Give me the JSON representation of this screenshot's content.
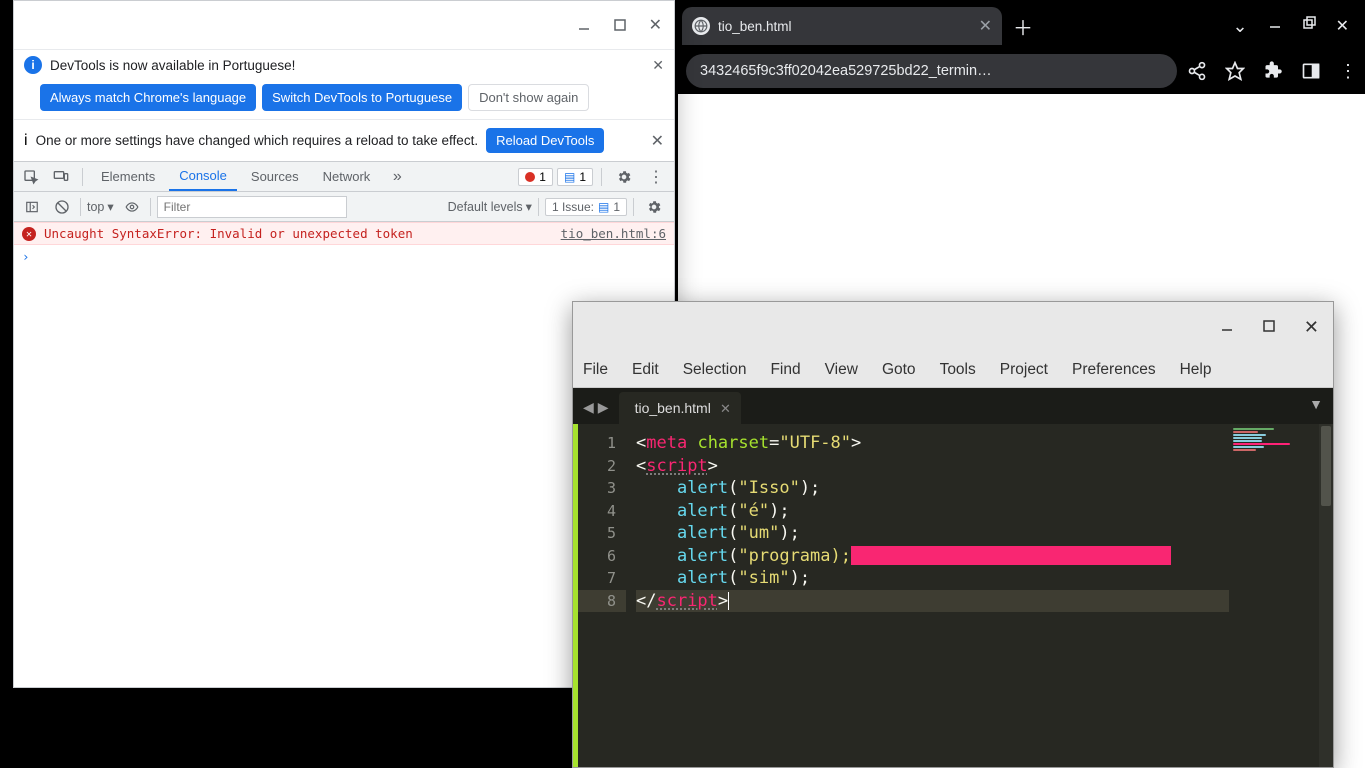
{
  "browser": {
    "tab_title": "tio_ben.html",
    "omnibox": "3432465f9c3ff02042ea529725bd22_termin…"
  },
  "devtools": {
    "lang_notice": "DevTools is now available in Portuguese!",
    "btn_always_match": "Always match Chrome's language",
    "btn_switch": "Switch DevTools to Portuguese",
    "btn_dont_show": "Don't show again",
    "reload_notice": "One or more settings have changed which requires a reload to take effect.",
    "btn_reload": "Reload DevTools",
    "tabs": {
      "elements": "Elements",
      "console": "Console",
      "sources": "Sources",
      "network": "Network"
    },
    "badge_errors": "1",
    "badge_msgs": "1",
    "context": "top",
    "filter_placeholder": "Filter",
    "levels_label": "Default levels",
    "issues_label": "1 Issue:",
    "issues_count": "1",
    "console_error": "Uncaught SyntaxError: Invalid or unexpected token",
    "console_error_src": "tio_ben.html:6",
    "prompt": "›"
  },
  "editor": {
    "menu": {
      "file": "File",
      "edit": "Edit",
      "selection": "Selection",
      "find": "Find",
      "view": "View",
      "goto": "Goto",
      "tools": "Tools",
      "project": "Project",
      "preferences": "Preferences",
      "help": "Help"
    },
    "tab_name": "tio_ben.html",
    "line_numbers": [
      "1",
      "2",
      "3",
      "4",
      "5",
      "6",
      "7",
      "8"
    ],
    "code": {
      "l1": {
        "open": "<",
        "tag": "meta",
        "sp": " ",
        "attr": "charset",
        "eq": "=",
        "str": "\"UTF-8\"",
        "close": ">"
      },
      "l2": {
        "open": "<",
        "tag": "script",
        "close": ">"
      },
      "l3": {
        "indent": "    ",
        "fn": "alert",
        "paren": "(",
        "str": "\"Isso\"",
        "end": ");"
      },
      "l4": {
        "indent": "    ",
        "fn": "alert",
        "paren": "(",
        "str": "\"é\"",
        "end": ");"
      },
      "l5": {
        "indent": "    ",
        "fn": "alert",
        "paren": "(",
        "str": "\"um\"",
        "end": ");"
      },
      "l6": {
        "indent": "    ",
        "fn": "alert",
        "paren": "(",
        "str": "\"programa);"
      },
      "l7": {
        "indent": "    ",
        "fn": "alert",
        "paren": "(",
        "str": "\"sim\"",
        "end": ");"
      },
      "l8": {
        "open": "</",
        "tag": "script",
        "close": ">"
      }
    }
  }
}
